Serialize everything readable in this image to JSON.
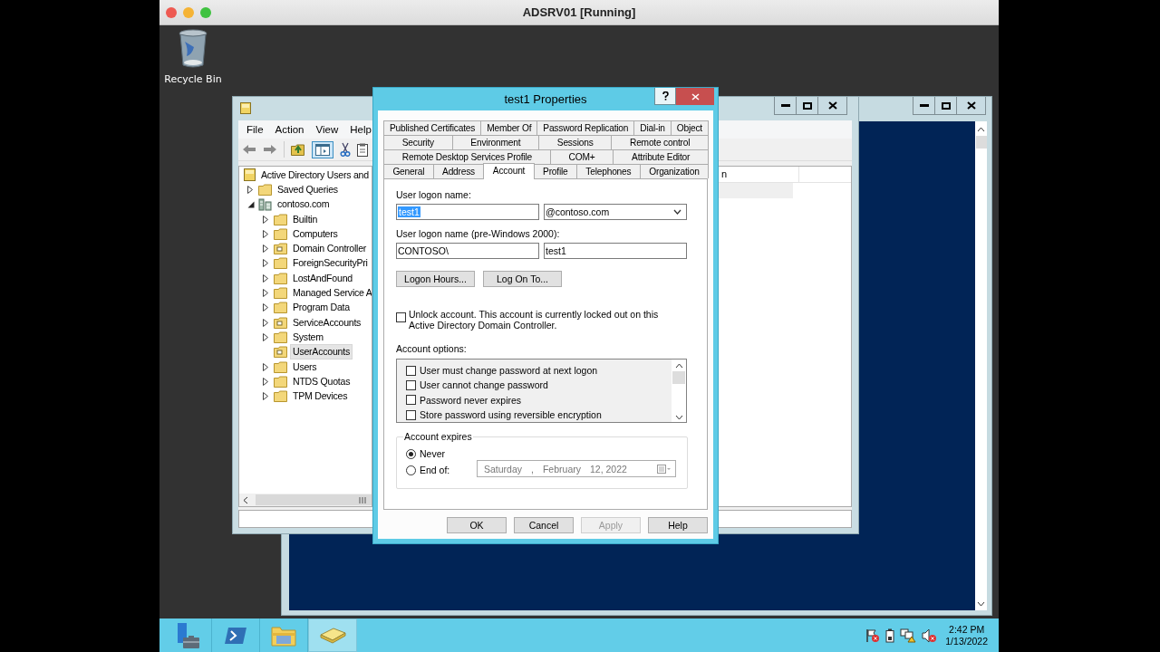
{
  "host_window": {
    "title": "ADSRV01 [Running]"
  },
  "desktop_icons": [
    {
      "label": "Recycle Bin"
    }
  ],
  "aduc_window": {
    "menu": [
      "File",
      "Action",
      "View",
      "Help"
    ],
    "tree": {
      "label": "Active Directory Users and",
      "kind": "root",
      "selected": false,
      "children": [
        {
          "label": "Saved Queries",
          "kind": "folder",
          "expandable": true,
          "expanded": false,
          "selected": false
        },
        {
          "label": "contoso.com",
          "kind": "domain",
          "expandable": true,
          "expanded": true,
          "selected": false,
          "children": [
            {
              "label": "Builtin",
              "kind": "folder",
              "expandable": true,
              "expanded": false,
              "selected": false
            },
            {
              "label": "Computers",
              "kind": "folder",
              "expandable": true,
              "expanded": false,
              "selected": false
            },
            {
              "label": "Domain Controller",
              "kind": "ou",
              "expandable": true,
              "expanded": false,
              "selected": false
            },
            {
              "label": "ForeignSecurityPri",
              "kind": "folder",
              "expandable": true,
              "expanded": false,
              "selected": false
            },
            {
              "label": "LostAndFound",
              "kind": "folder",
              "expandable": true,
              "expanded": false,
              "selected": false
            },
            {
              "label": "Managed Service A",
              "kind": "folder",
              "expandable": true,
              "expanded": false,
              "selected": false
            },
            {
              "label": "Program Data",
              "kind": "folder",
              "expandable": true,
              "expanded": false,
              "selected": false
            },
            {
              "label": "ServiceAccounts",
              "kind": "ou",
              "expandable": true,
              "expanded": false,
              "selected": false
            },
            {
              "label": "System",
              "kind": "folder",
              "expandable": true,
              "expanded": false,
              "selected": false
            },
            {
              "label": "UserAccounts",
              "kind": "ou",
              "expandable": false,
              "selected": true
            },
            {
              "label": "Users",
              "kind": "folder",
              "expandable": true,
              "expanded": false,
              "selected": false
            },
            {
              "label": "NTDS Quotas",
              "kind": "folder",
              "expandable": true,
              "expanded": false,
              "selected": false
            },
            {
              "label": "TPM Devices",
              "kind": "folder",
              "expandable": true,
              "expanded": false,
              "selected": false
            }
          ]
        }
      ]
    },
    "list_columns": [
      "n"
    ]
  },
  "dialog": {
    "title": "test1 Properties",
    "tab_rows": [
      [
        {
          "label": "Published Certificates",
          "selected": false
        },
        {
          "label": "Member Of",
          "selected": false
        },
        {
          "label": "Password Replication",
          "selected": false
        },
        {
          "label": "Dial-in",
          "selected": false
        },
        {
          "label": "Object",
          "selected": false
        }
      ],
      [
        {
          "label": "Security",
          "selected": false
        },
        {
          "label": "Environment",
          "selected": false
        },
        {
          "label": "Sessions",
          "selected": false
        },
        {
          "label": "Remote control",
          "selected": false
        }
      ],
      [
        {
          "label": "Remote Desktop Services Profile",
          "selected": false
        },
        {
          "label": "COM+",
          "selected": false
        },
        {
          "label": "Attribute Editor",
          "selected": false
        }
      ],
      [
        {
          "label": "General",
          "selected": false
        },
        {
          "label": "Address",
          "selected": false
        },
        {
          "label": "Account",
          "selected": true
        },
        {
          "label": "Profile",
          "selected": false
        },
        {
          "label": "Telephones",
          "selected": false
        },
        {
          "label": "Organization",
          "selected": false
        }
      ]
    ],
    "logon_name": {
      "label": "User logon name:",
      "value": "test1",
      "domain": "@contoso.com"
    },
    "pre2000": {
      "label": "User logon name (pre-Windows 2000):",
      "domain": "CONTOSO\\",
      "value": "test1"
    },
    "buttons": [
      "Logon Hours...",
      "Log On To..."
    ],
    "unlock": {
      "label": "Unlock account. This account is currently locked out on this Active Directory Domain Controller.",
      "checked": false
    },
    "account_options": {
      "label": "Account options:",
      "items": [
        {
          "label": "User must change password at next logon",
          "checked": false
        },
        {
          "label": "User cannot change password",
          "checked": false
        },
        {
          "label": "Password never expires",
          "checked": false
        },
        {
          "label": "Store password using reversible encryption",
          "checked": false
        }
      ]
    },
    "expires": {
      "label": "Account expires",
      "options": [
        {
          "label": "Never",
          "selected": true
        },
        {
          "label": "End of:",
          "selected": false
        }
      ],
      "date_parts": [
        "Saturday",
        ",",
        "February",
        "12, 2022"
      ],
      "date_disabled": true
    },
    "footer_buttons": [
      {
        "label": "OK",
        "disabled": false
      },
      {
        "label": "Cancel",
        "disabled": false
      },
      {
        "label": "Apply",
        "disabled": true
      },
      {
        "label": "Help",
        "disabled": false
      }
    ]
  },
  "taskbar": {
    "apps": [
      {
        "selected": false
      },
      {
        "selected": false
      },
      {
        "selected": false
      },
      {
        "selected": true
      }
    ],
    "time": "2:42 PM",
    "date": "1/13/2022"
  }
}
